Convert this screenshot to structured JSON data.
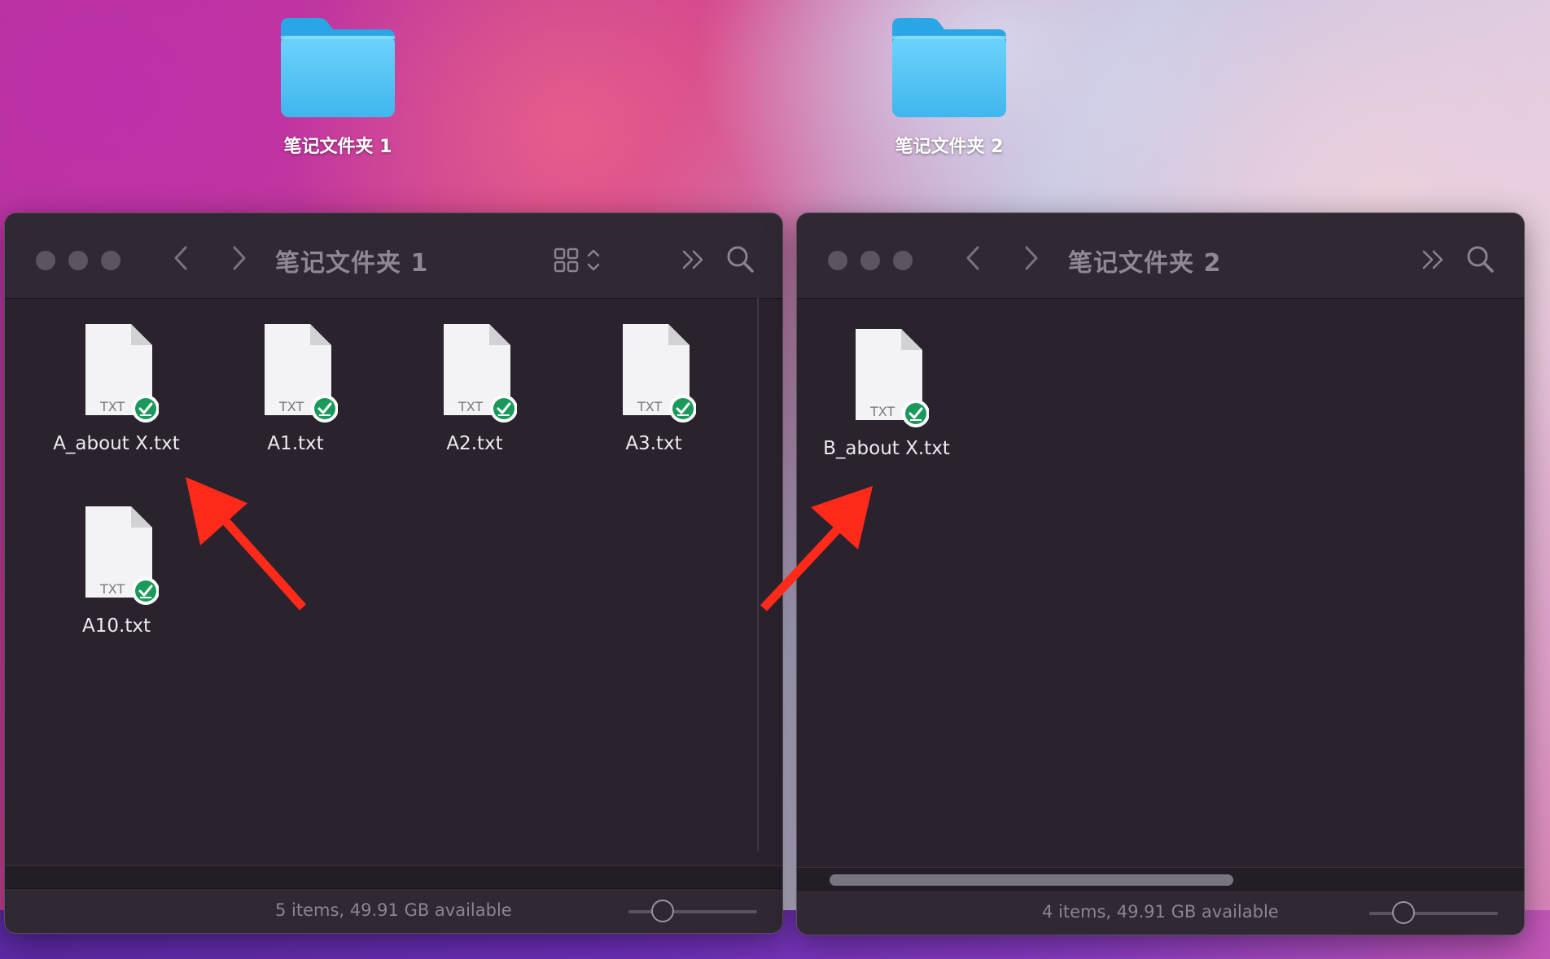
{
  "desktop": {
    "folders": [
      {
        "label": "笔记文件夹 1"
      },
      {
        "label": "笔记文件夹 2"
      }
    ]
  },
  "window1": {
    "title": "笔记文件夹 1",
    "files": [
      {
        "name": "A_about X.txt",
        "type": "TXT"
      },
      {
        "name": "A1.txt",
        "type": "TXT"
      },
      {
        "name": "A2.txt",
        "type": "TXT"
      },
      {
        "name": "A3.txt",
        "type": "TXT"
      },
      {
        "name": "A10.txt",
        "type": "TXT"
      }
    ],
    "status": "5 items, 49.91 GB available",
    "icon_size_level": 0.27
  },
  "window2": {
    "title": "笔记文件夹 2",
    "files": [
      {
        "name": "B_about X.txt",
        "type": "TXT"
      }
    ],
    "status": "4 items, 49.91 GB available",
    "icon_size_level": 0.27
  },
  "colors": {
    "window_bg": "#2a222d",
    "toolbar_bg": "#302933",
    "folder_blue": "#4fc3f7",
    "sync_badge_green": "#1a9a5a",
    "annotation_arrow": "#ff2a1a"
  },
  "icons": {
    "folder": "folder-icon",
    "file": "txt-document-icon",
    "badge": "synced-checkmark-icon",
    "back": "chevron-left-icon",
    "forward": "chevron-right-icon",
    "view": "icon-grid-view-icon",
    "more": "double-chevron-right-icon",
    "search": "search-icon"
  }
}
